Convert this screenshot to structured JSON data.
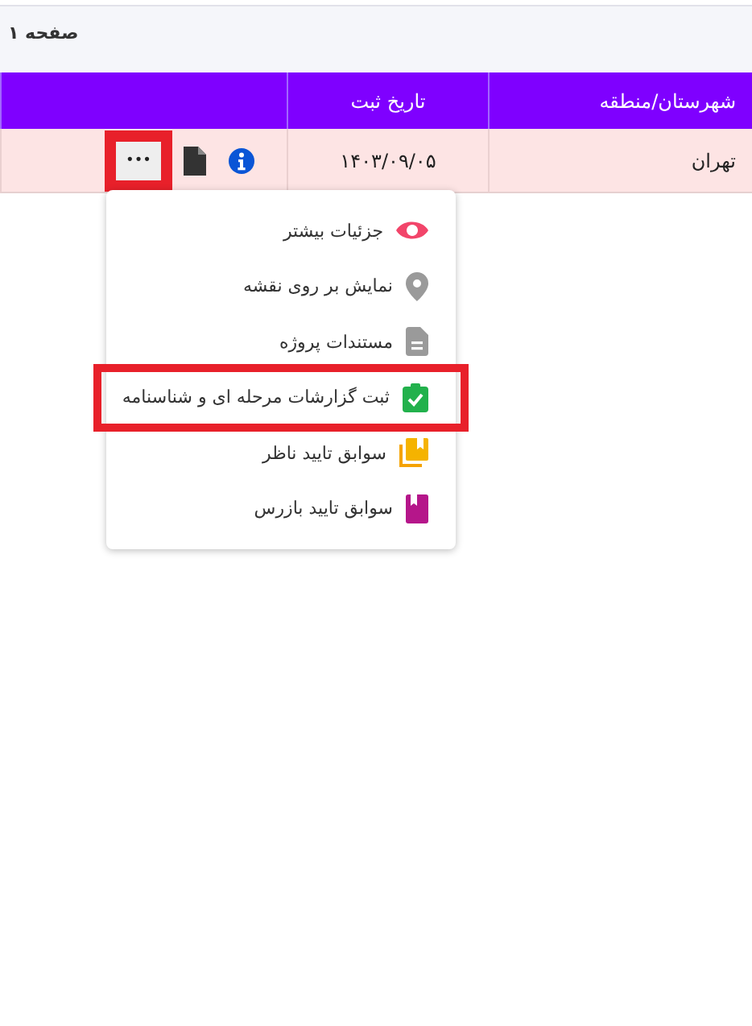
{
  "page_label": "صفحه ۱",
  "table": {
    "columns": [
      "شهرستان/منطقه",
      "تاریخ ثبت"
    ],
    "rows": [
      {
        "city": "تهران",
        "date": "۱۴۰۳/۰۹/۰۵",
        "actions": [
          {
            "kind": "info"
          },
          {
            "kind": "document"
          },
          {
            "kind": "more",
            "label": "•••",
            "highlighted": true
          }
        ]
      }
    ]
  },
  "menu": {
    "items": [
      {
        "kind": "eye",
        "label": "جزئیات بیشتر",
        "highlighted": false
      },
      {
        "kind": "pin",
        "label": "نمایش بر روی نقشه",
        "highlighted": false
      },
      {
        "kind": "file",
        "label": "مستندات پروژه",
        "highlighted": false
      },
      {
        "kind": "check",
        "label": "ثبت گزارشات مرحله ای و شناسنامه",
        "highlighted": true
      },
      {
        "kind": "copies",
        "label": "سوابق تایید ناظر",
        "highlighted": false
      },
      {
        "kind": "book",
        "label": "سوابق تایید بازرس",
        "highlighted": false
      }
    ]
  }
}
